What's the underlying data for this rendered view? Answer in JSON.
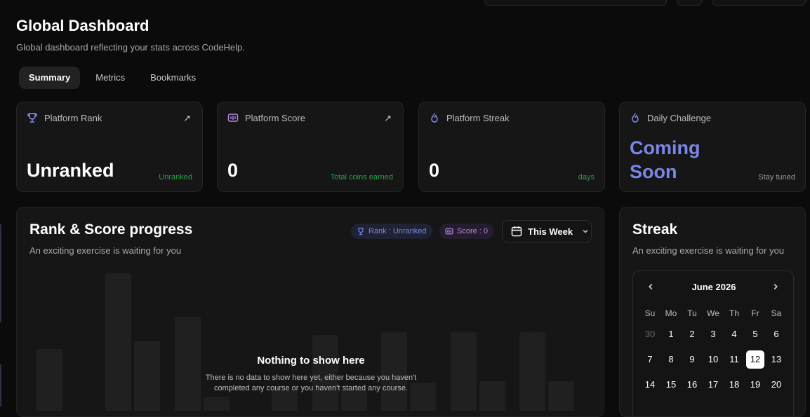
{
  "header": {
    "title": "Global Dashboard",
    "subtitle": "Global dashboard reflecting your stats across CodeHelp."
  },
  "tabs": [
    {
      "label": "Summary",
      "active": true
    },
    {
      "label": "Metrics",
      "active": false
    },
    {
      "label": "Bookmarks",
      "active": false
    }
  ],
  "cards": {
    "rank": {
      "label": "Platform Rank",
      "value": "Unranked",
      "note": "Unranked",
      "icon": "trophy-icon"
    },
    "score": {
      "label": "Platform Score",
      "value": "0",
      "note": "Total coins earned",
      "icon": "coins-icon"
    },
    "streak": {
      "label": "Platform Streak",
      "value": "0",
      "note": "days",
      "icon": "flame-icon"
    },
    "challenge": {
      "label": "Daily Challenge",
      "value_line1": "Coming",
      "value_line2": "Soon",
      "note": "Stay tuned",
      "icon": "flame-icon"
    }
  },
  "progress": {
    "title": "Rank & Score progress",
    "subtitle": "An exciting exercise is waiting for you",
    "rank_badge": "Rank : Unranked",
    "score_badge": "Score : 0",
    "period": "This Week",
    "empty_title": "Nothing to show here",
    "empty_text": "There is no data to show here yet, either because you haven't completed any course or you haven't started any course."
  },
  "streak": {
    "title": "Streak",
    "subtitle": "An exciting exercise is waiting for you",
    "calendar": {
      "month": "June 2026",
      "weekdays": [
        "Su",
        "Mo",
        "Tu",
        "We",
        "Th",
        "Fr",
        "Sa"
      ],
      "days": [
        "30",
        "1",
        "2",
        "3",
        "4",
        "5",
        "6",
        "7",
        "8",
        "9",
        "10",
        "11",
        "12",
        "13",
        "14",
        "15",
        "16",
        "17",
        "18",
        "19",
        "20"
      ],
      "muted_days": [
        "30"
      ],
      "today": "12"
    }
  },
  "colors": {
    "accent": "#7b86e6",
    "positive": "#2e9e46",
    "card_bg": "#161616"
  }
}
